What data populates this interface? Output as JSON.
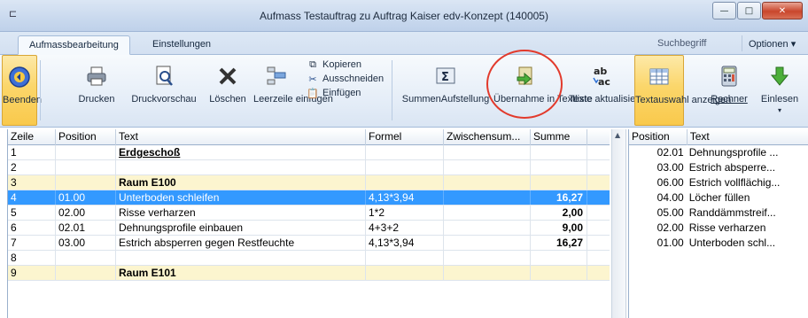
{
  "window": {
    "title": "Aufmass Testauftrag zu Auftrag Kaiser edv-Konzept (140005)",
    "app_icon": "app-icon",
    "minimize_glyph": "—",
    "maximize_glyph": "□",
    "close_glyph": "✕"
  },
  "tabs": [
    {
      "label": "Aufmassbearbeitung",
      "active": true
    },
    {
      "label": "Einstellungen",
      "active": false
    }
  ],
  "search": {
    "label": "Suchbegriff"
  },
  "options_menu": {
    "label": "Optionen ▾"
  },
  "ribbon": {
    "buttons": [
      {
        "id": "beenden",
        "label": "Beenden",
        "icon": "exit-circle-icon",
        "active": true
      },
      {
        "id": "drucken",
        "label": "Drucken",
        "icon": "printer-icon"
      },
      {
        "id": "druckvorschau",
        "label": "Druckvorschau",
        "icon": "print-preview-icon"
      },
      {
        "id": "loeschen",
        "label": "Löschen",
        "icon": "delete-x-icon"
      },
      {
        "id": "leerzeile",
        "label": "Leerzeile einfügen",
        "icon": "insert-row-icon"
      },
      {
        "id": "summenaufstellung",
        "label": "SummenAufstellung",
        "icon": "sigma-icon"
      },
      {
        "id": "uebernahme",
        "label": "Übernahme in Textliste",
        "icon": "transfer-icon"
      },
      {
        "id": "texte",
        "label": "Texte aktualisieren",
        "icon": "ab-ac-icon"
      },
      {
        "id": "textauswahl",
        "label": "Textauswahl anzeigen",
        "icon": "table-icon",
        "active": true
      },
      {
        "id": "rechner",
        "label": "Rechner",
        "icon": "calculator-icon"
      },
      {
        "id": "einlesen",
        "label": "Einlesen",
        "icon": "download-arrow-icon"
      }
    ],
    "clipboard": [
      {
        "label": "Kopieren",
        "icon": "copy-icon"
      },
      {
        "label": "Ausschneiden",
        "icon": "scissors-icon"
      },
      {
        "label": "Einfügen",
        "icon": "paste-icon"
      }
    ]
  },
  "grid": {
    "columns": [
      "Zeile",
      "Position",
      "Text",
      "Formel",
      "Zwischensum...",
      "Summe"
    ],
    "rows": [
      {
        "zeile": "1",
        "position": "",
        "text": "Erdgeschoß",
        "formel": "",
        "zwischensumme": "",
        "summe": "",
        "type": "heading"
      },
      {
        "zeile": "2",
        "position": "",
        "text": "",
        "formel": "",
        "zwischensumme": "",
        "summe": "",
        "type": "empty"
      },
      {
        "zeile": "3",
        "position": "",
        "text": "Raum E100",
        "formel": "",
        "zwischensumme": "",
        "summe": "",
        "type": "room"
      },
      {
        "zeile": "4",
        "position": "01.00",
        "text": "Unterboden schleifen",
        "formel": "4,13*3,94",
        "zwischensumme": "",
        "summe": "16,27",
        "type": "selected"
      },
      {
        "zeile": "5",
        "position": "02.00",
        "text": "Risse verharzen",
        "formel": "1*2",
        "zwischensumme": "",
        "summe": "2,00",
        "type": "item"
      },
      {
        "zeile": "6",
        "position": "02.01",
        "text": "Dehnungsprofile einbauen",
        "formel": "4+3+2",
        "zwischensumme": "",
        "summe": "9,00",
        "type": "item"
      },
      {
        "zeile": "7",
        "position": "03.00",
        "text": "Estrich absperren gegen Restfeuchte",
        "formel": "4,13*3,94",
        "zwischensumme": "",
        "summe": "16,27",
        "type": "item"
      },
      {
        "zeile": "8",
        "position": "",
        "text": "",
        "formel": "",
        "zwischensumme": "",
        "summe": "",
        "type": "empty"
      },
      {
        "zeile": "9",
        "position": "",
        "text": "Raum E101",
        "formel": "",
        "zwischensumme": "",
        "summe": "",
        "type": "room"
      }
    ]
  },
  "textlist": {
    "columns": [
      "Position",
      "Text"
    ],
    "rows": [
      {
        "position": "02.01",
        "text": "Dehnungsprofile ..."
      },
      {
        "position": "03.00",
        "text": "Estrich absperre..."
      },
      {
        "position": "06.00",
        "text": "Estrich vollflächig..."
      },
      {
        "position": "04.00",
        "text": "Löcher füllen"
      },
      {
        "position": "05.00",
        "text": "Randdämmstreif..."
      },
      {
        "position": "02.00",
        "text": "Risse verharzen"
      },
      {
        "position": "01.00",
        "text": "Unterboden schl..."
      }
    ]
  },
  "colors": {
    "selection": "#3399ff",
    "room_row": "#fcf5cf",
    "active_button": "#fbd66a",
    "highlight_circle": "#e23a2c"
  }
}
